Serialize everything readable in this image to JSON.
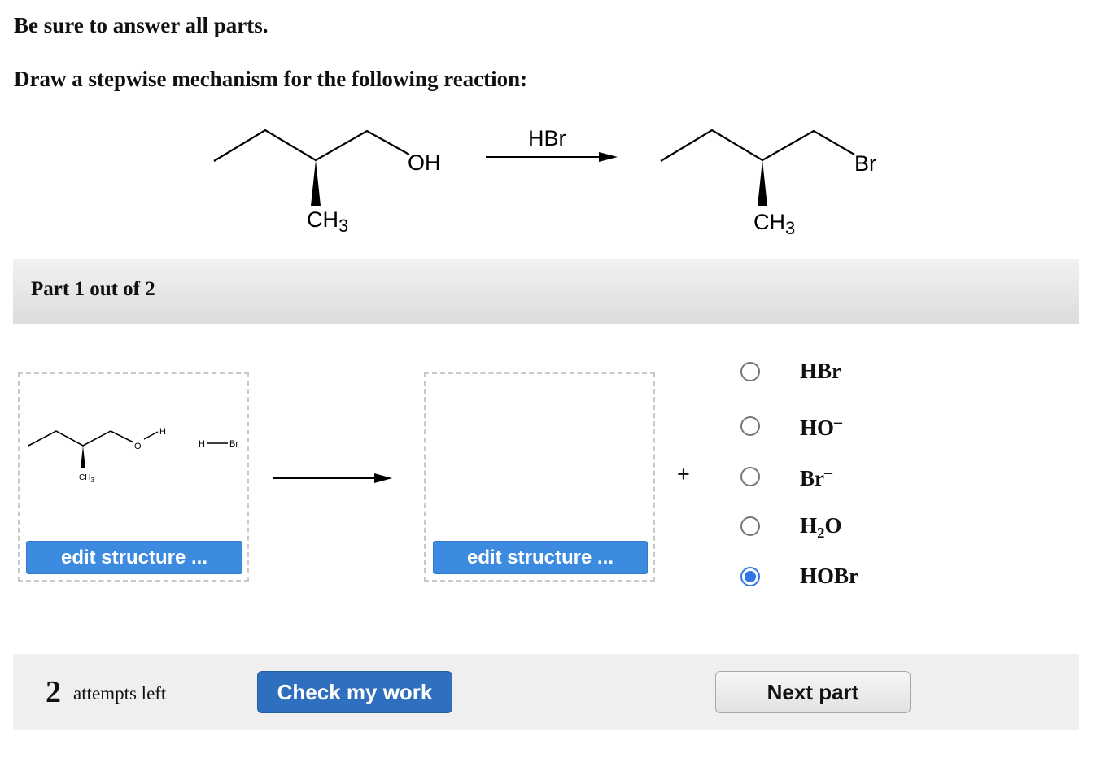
{
  "instructions": {
    "line1": "Be sure to answer all parts.",
    "line2": "Draw a stepwise mechanism for the following reaction:"
  },
  "reaction": {
    "reagent": "HBr",
    "reactant_oh": "OH",
    "reactant_methyl": "CH",
    "product_br": "Br",
    "product_methyl": "CH",
    "subscript_3": "3"
  },
  "part": {
    "title": "Part 1 out of 2"
  },
  "workspace": {
    "start_structure": {
      "h_label": "H",
      "o_label": "O",
      "ch3_label": "CH",
      "ch3_sub": "3",
      "hbr_h": "H",
      "hbr_br": "Br"
    },
    "edit_button_label": "edit structure ...",
    "plus_sign": "+"
  },
  "options": [
    {
      "formula": "HBr",
      "selected": false
    },
    {
      "formula": "HO",
      "charge": "–",
      "selected": false
    },
    {
      "formula": "Br",
      "charge": "–",
      "selected": false
    },
    {
      "formula": "H",
      "sub": "2",
      "tail": "O",
      "selected": false
    },
    {
      "formula": "HOBr",
      "selected": true
    }
  ],
  "footer": {
    "attempts_count": "2",
    "attempts_label": "attempts left",
    "check_button": "Check my work",
    "next_button": "Next part"
  },
  "colors": {
    "primary_button": "#2e6fbf",
    "edit_button": "#3d8be0",
    "radio_selected": "#2f77e6"
  }
}
